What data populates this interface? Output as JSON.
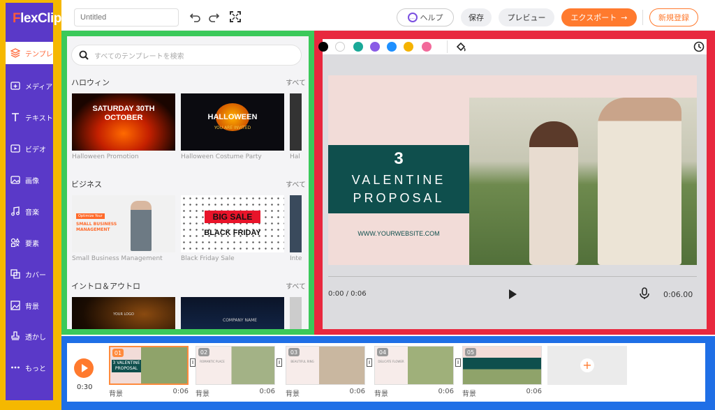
{
  "app": {
    "logo": "FlexClip"
  },
  "sidebar": {
    "items": [
      {
        "label": "テンプレ",
        "icon": "layers-icon"
      },
      {
        "label": "メディア",
        "icon": "folder-plus-icon"
      },
      {
        "label": "テキスト",
        "icon": "text-icon"
      },
      {
        "label": "ビデオ",
        "icon": "video-icon"
      },
      {
        "label": "画像",
        "icon": "image-icon"
      },
      {
        "label": "音楽",
        "icon": "music-icon"
      },
      {
        "label": "要素",
        "icon": "elements-icon"
      },
      {
        "label": "カバー",
        "icon": "cover-icon"
      },
      {
        "label": "背景",
        "icon": "background-icon"
      },
      {
        "label": "透かし",
        "icon": "watermark-icon"
      },
      {
        "label": "もっと",
        "icon": "more-icon"
      }
    ]
  },
  "topbar": {
    "title_placeholder": "Untitled",
    "help": "ヘルプ",
    "save": "保存",
    "preview": "プレビュー",
    "export": "エクスポート",
    "signup": "新規登録"
  },
  "templates": {
    "search_placeholder": "すべてのテンプレートを検索",
    "see_all": "すべて",
    "categories": [
      {
        "name": "ハロウィン",
        "items": [
          {
            "caption": "Halloween Promotion",
            "text": "SATURDAY 30TH OCTOBER"
          },
          {
            "caption": "Halloween Costume Party",
            "text": "HALLOWEEN",
            "sub": "YOU ARE INVITED"
          },
          {
            "caption": "Hal"
          }
        ]
      },
      {
        "name": "ビジネス",
        "items": [
          {
            "caption": "Small Business Management",
            "text": "SMALL BUSINESS MANAGEMENT",
            "tag": "Optimize Your"
          },
          {
            "caption": "Black Friday Sale",
            "text": "BIG SALE",
            "sub": "BLACK FRIDAY"
          },
          {
            "caption": "Inte"
          }
        ]
      },
      {
        "name": "イントロ＆アウトロ",
        "items": [
          {
            "caption": "",
            "text": "YOUR LOGO"
          },
          {
            "caption": "",
            "text": "COMPANY NAME"
          },
          {
            "caption": ""
          }
        ]
      }
    ]
  },
  "preview": {
    "colors": [
      "#000000",
      "#ffffff",
      "#1aa998",
      "#8a5ce6",
      "#1e90ff",
      "#f5b301",
      "#f26a9b"
    ],
    "slide": {
      "number": "3",
      "line1": "VALENTINE",
      "line2": "PROPOSAL",
      "website": "WWW.YOURWEBSITE.COM",
      "accent": "#0f4f4d"
    },
    "player": {
      "time": "0:00 / 0:06",
      "duration": "0:06.00"
    }
  },
  "timeline": {
    "total": "0:30",
    "clips": [
      {
        "num": "01",
        "label": "背景",
        "dur": "0:06",
        "text": "3 VALENTINE PROPOSAL"
      },
      {
        "num": "02",
        "label": "背景",
        "dur": "0:06",
        "text": "ROMANTIC PLACE"
      },
      {
        "num": "03",
        "label": "背景",
        "dur": "0:06",
        "text": "BEAUTIFUL RING"
      },
      {
        "num": "04",
        "label": "背景",
        "dur": "0:06",
        "text": "DELICATE FLOWER"
      },
      {
        "num": "05",
        "label": "背景",
        "dur": "0:06",
        "text": ""
      }
    ]
  }
}
